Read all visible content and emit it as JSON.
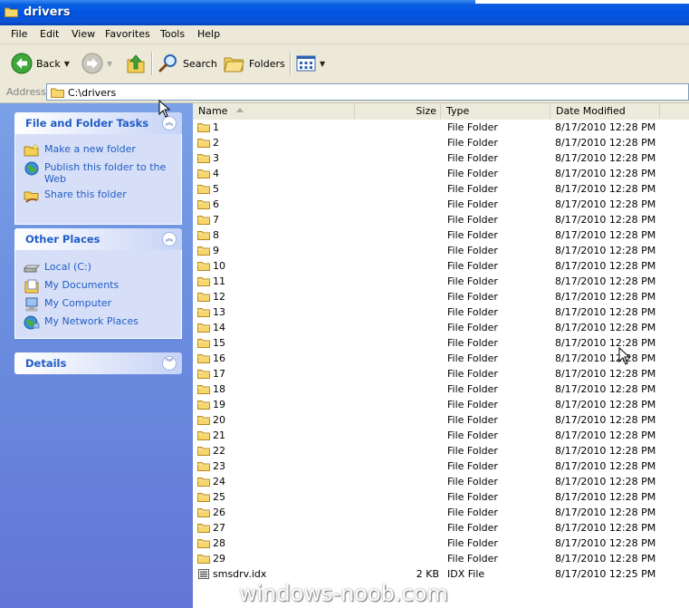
{
  "window": {
    "title": "drivers"
  },
  "menu": [
    "File",
    "Edit",
    "View",
    "Favorites",
    "Tools",
    "Help"
  ],
  "toolbar": {
    "back": "Back",
    "search": "Search",
    "folders": "Folders"
  },
  "address": {
    "label": "Address",
    "value": "C:\\drivers"
  },
  "tasks_panel": {
    "title": "File and Folder Tasks",
    "items": [
      "Make a new folder",
      "Publish this folder to the Web",
      "Share this folder"
    ]
  },
  "places_panel": {
    "title": "Other Places",
    "items": [
      "Local (C:)",
      "My Documents",
      "My Computer",
      "My Network Places"
    ]
  },
  "details_panel": {
    "title": "Details"
  },
  "columns": {
    "name": "Name",
    "size": "Size",
    "type": "Type",
    "date": "Date Modified"
  },
  "files": [
    {
      "name": "1",
      "size": "",
      "type": "File Folder",
      "date": "8/17/2010 12:28 PM",
      "icon": "folder-icon"
    },
    {
      "name": "2",
      "size": "",
      "type": "File Folder",
      "date": "8/17/2010 12:28 PM",
      "icon": "folder-icon"
    },
    {
      "name": "3",
      "size": "",
      "type": "File Folder",
      "date": "8/17/2010 12:28 PM",
      "icon": "folder-icon"
    },
    {
      "name": "4",
      "size": "",
      "type": "File Folder",
      "date": "8/17/2010 12:28 PM",
      "icon": "folder-icon"
    },
    {
      "name": "5",
      "size": "",
      "type": "File Folder",
      "date": "8/17/2010 12:28 PM",
      "icon": "folder-icon"
    },
    {
      "name": "6",
      "size": "",
      "type": "File Folder",
      "date": "8/17/2010 12:28 PM",
      "icon": "folder-icon"
    },
    {
      "name": "7",
      "size": "",
      "type": "File Folder",
      "date": "8/17/2010 12:28 PM",
      "icon": "folder-icon"
    },
    {
      "name": "8",
      "size": "",
      "type": "File Folder",
      "date": "8/17/2010 12:28 PM",
      "icon": "folder-icon"
    },
    {
      "name": "9",
      "size": "",
      "type": "File Folder",
      "date": "8/17/2010 12:28 PM",
      "icon": "folder-icon"
    },
    {
      "name": "10",
      "size": "",
      "type": "File Folder",
      "date": "8/17/2010 12:28 PM",
      "icon": "folder-icon"
    },
    {
      "name": "11",
      "size": "",
      "type": "File Folder",
      "date": "8/17/2010 12:28 PM",
      "icon": "folder-icon"
    },
    {
      "name": "12",
      "size": "",
      "type": "File Folder",
      "date": "8/17/2010 12:28 PM",
      "icon": "folder-icon"
    },
    {
      "name": "13",
      "size": "",
      "type": "File Folder",
      "date": "8/17/2010 12:28 PM",
      "icon": "folder-icon"
    },
    {
      "name": "14",
      "size": "",
      "type": "File Folder",
      "date": "8/17/2010 12:28 PM",
      "icon": "folder-icon"
    },
    {
      "name": "15",
      "size": "",
      "type": "File Folder",
      "date": "8/17/2010 12:28 PM",
      "icon": "folder-icon"
    },
    {
      "name": "16",
      "size": "",
      "type": "File Folder",
      "date": "8/17/2010 12:28 PM",
      "icon": "folder-icon"
    },
    {
      "name": "17",
      "size": "",
      "type": "File Folder",
      "date": "8/17/2010 12:28 PM",
      "icon": "folder-icon"
    },
    {
      "name": "18",
      "size": "",
      "type": "File Folder",
      "date": "8/17/2010 12:28 PM",
      "icon": "folder-icon"
    },
    {
      "name": "19",
      "size": "",
      "type": "File Folder",
      "date": "8/17/2010 12:28 PM",
      "icon": "folder-icon"
    },
    {
      "name": "20",
      "size": "",
      "type": "File Folder",
      "date": "8/17/2010 12:28 PM",
      "icon": "folder-icon"
    },
    {
      "name": "21",
      "size": "",
      "type": "File Folder",
      "date": "8/17/2010 12:28 PM",
      "icon": "folder-icon"
    },
    {
      "name": "22",
      "size": "",
      "type": "File Folder",
      "date": "8/17/2010 12:28 PM",
      "icon": "folder-icon"
    },
    {
      "name": "23",
      "size": "",
      "type": "File Folder",
      "date": "8/17/2010 12:28 PM",
      "icon": "folder-icon"
    },
    {
      "name": "24",
      "size": "",
      "type": "File Folder",
      "date": "8/17/2010 12:28 PM",
      "icon": "folder-icon"
    },
    {
      "name": "25",
      "size": "",
      "type": "File Folder",
      "date": "8/17/2010 12:28 PM",
      "icon": "folder-icon"
    },
    {
      "name": "26",
      "size": "",
      "type": "File Folder",
      "date": "8/17/2010 12:28 PM",
      "icon": "folder-icon"
    },
    {
      "name": "27",
      "size": "",
      "type": "File Folder",
      "date": "8/17/2010 12:28 PM",
      "icon": "folder-icon"
    },
    {
      "name": "28",
      "size": "",
      "type": "File Folder",
      "date": "8/17/2010 12:28 PM",
      "icon": "folder-icon"
    },
    {
      "name": "29",
      "size": "",
      "type": "File Folder",
      "date": "8/17/2010 12:28 PM",
      "icon": "folder-icon"
    },
    {
      "name": "smsdrv.idx",
      "size": "2 KB",
      "type": "IDX File",
      "date": "8/17/2010 12:25 PM",
      "icon": "idx-file-icon"
    }
  ],
  "watermark": "windows-noob.com",
  "colors": {
    "title_bar": "#0054e3",
    "task_pane": "#6b8fe0",
    "link_blue": "#215dc6",
    "chrome": "#ece9d8"
  }
}
